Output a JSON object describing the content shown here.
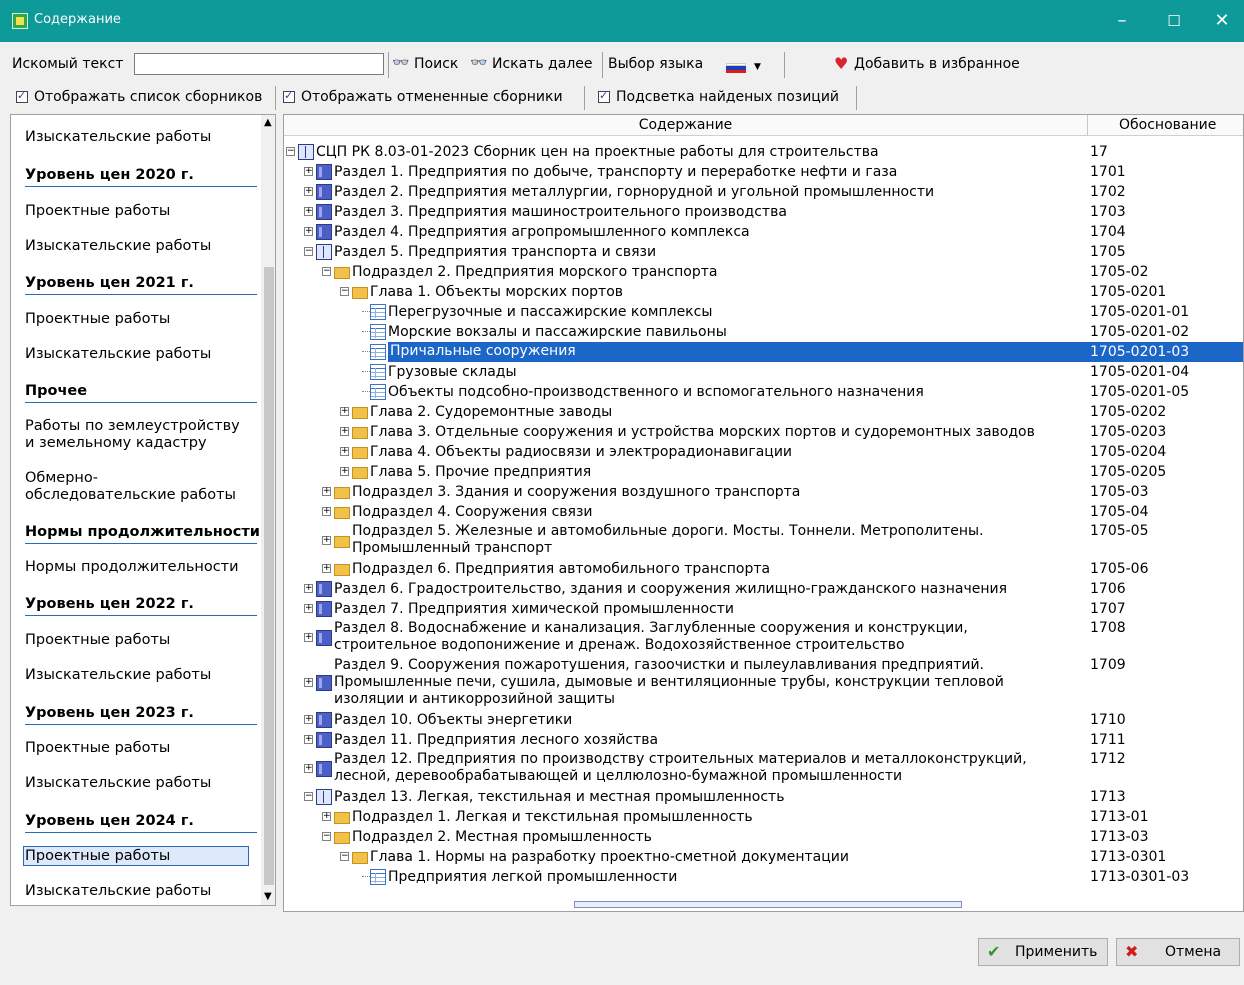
{
  "window": {
    "title": "Содержание",
    "minimize": "–",
    "maximize": "☐",
    "close": "✕"
  },
  "toolbar": {
    "search_label": "Искомый текст",
    "search_value": "",
    "find_btn": "Поиск",
    "find_next_btn": "Искать далее",
    "language_label": "Выбор языка",
    "favorite_btn": "Добавить в избранное",
    "show_collections": "Отображать список сборников",
    "show_cancelled": "Отображать отмененные сборники",
    "highlight_found": "Подсветка найденых позиций"
  },
  "left_panel": [
    {
      "type": "item",
      "label": "Изыскательские работы"
    },
    {
      "type": "head",
      "label": "Уровень цен 2020 г."
    },
    {
      "type": "item",
      "label": "Проектные работы"
    },
    {
      "type": "item",
      "label": "Изыскательские работы"
    },
    {
      "type": "head",
      "label": "Уровень цен 2021 г."
    },
    {
      "type": "item",
      "label": "Проектные работы"
    },
    {
      "type": "item",
      "label": "Изыскательские работы"
    },
    {
      "type": "head",
      "label": "Прочее"
    },
    {
      "type": "item",
      "label": "Работы по землеустройству и земельному кадастру"
    },
    {
      "type": "item",
      "label": "Обмерно-обследовательские работы"
    },
    {
      "type": "head",
      "label": "Нормы продолжительности"
    },
    {
      "type": "item",
      "label": "Нормы продолжительности"
    },
    {
      "type": "head",
      "label": "Уровень цен 2022 г."
    },
    {
      "type": "item",
      "label": "Проектные работы"
    },
    {
      "type": "item",
      "label": "Изыскательские работы"
    },
    {
      "type": "head",
      "label": "Уровень цен 2023 г."
    },
    {
      "type": "item",
      "label": "Проектные работы"
    },
    {
      "type": "item",
      "label": "Изыскательские работы"
    },
    {
      "type": "head",
      "label": "Уровень цен 2024 г."
    },
    {
      "type": "item",
      "label": "Проектные работы",
      "selected": true
    },
    {
      "type": "item",
      "label": "Изыскательские работы"
    }
  ],
  "tree": {
    "col_content": "Содержание",
    "col_basis": "Обоснование",
    "rows": [
      {
        "level": 0,
        "exp": "−",
        "icon": "open",
        "text": "СЦП РК 8.03-01-2023 Сборник цен на проектные работы для строительства",
        "code": "17"
      },
      {
        "level": 1,
        "exp": "+",
        "icon": "book",
        "text": "Раздел 1. Предприятия по добыче, транспорту и переработке нефти и газа",
        "code": "1701"
      },
      {
        "level": 1,
        "exp": "+",
        "icon": "book",
        "text": "Раздел 2. Предприятия металлургии, горнорудной и угольной промышленности",
        "code": "1702"
      },
      {
        "level": 1,
        "exp": "+",
        "icon": "book",
        "text": "Раздел 3. Предприятия машиностроительного производства",
        "code": "1703"
      },
      {
        "level": 1,
        "exp": "+",
        "icon": "book",
        "text": "Раздел 4. Предприятия агропромышленного комплекса",
        "code": "1704"
      },
      {
        "level": 1,
        "exp": "−",
        "icon": "open",
        "text": "Раздел 5. Предприятия транспорта и связи",
        "code": "1705"
      },
      {
        "level": 2,
        "exp": "−",
        "icon": "folder",
        "text": "Подраздел 2. Предприятия морского транспорта",
        "code": "1705-02"
      },
      {
        "level": 3,
        "exp": "−",
        "icon": "folder",
        "text": "Глава 1. Объекты морских портов",
        "code": "1705-0201"
      },
      {
        "level": 4,
        "exp": "",
        "icon": "table",
        "text": "Перегрузочные и пассажирские комплексы",
        "code": "1705-0201-01"
      },
      {
        "level": 4,
        "exp": "",
        "icon": "table",
        "text": "Морские вокзалы и пассажирские павильоны",
        "code": "1705-0201-02"
      },
      {
        "level": 4,
        "exp": "",
        "icon": "table",
        "text": "Причальные сооружения",
        "code": "1705-0201-03",
        "selected": true
      },
      {
        "level": 4,
        "exp": "",
        "icon": "table",
        "text": "Грузовые склады",
        "code": "1705-0201-04"
      },
      {
        "level": 4,
        "exp": "",
        "icon": "table",
        "text": "Объекты подсобно-производственного и вспомогательного назначения",
        "code": "1705-0201-05"
      },
      {
        "level": 3,
        "exp": "+",
        "icon": "folder",
        "text": "Глава 2. Судоремонтные заводы",
        "code": "1705-0202"
      },
      {
        "level": 3,
        "exp": "+",
        "icon": "folder",
        "text": "Глава 3. Отдельные сооружения и устройства морских портов и судоремонтных заводов",
        "code": "1705-0203"
      },
      {
        "level": 3,
        "exp": "+",
        "icon": "folder",
        "text": "Глава 4. Объекты радиосвязи и электрорадионавигации",
        "code": "1705-0204"
      },
      {
        "level": 3,
        "exp": "+",
        "icon": "folder",
        "text": "Глава 5. Прочие предприятия",
        "code": "1705-0205"
      },
      {
        "level": 2,
        "exp": "+",
        "icon": "folder",
        "text": "Подраздел 3. Здания и сооружения воздушного транспорта",
        "code": "1705-03"
      },
      {
        "level": 2,
        "exp": "+",
        "icon": "folder",
        "text": "Подраздел 4. Сооружения связи",
        "code": "1705-04"
      },
      {
        "level": 2,
        "exp": "+",
        "icon": "folder",
        "text": "Подраздел 5. Железные и автомобильные дороги. Мосты. Тоннели. Метрополитены.\nПромышленный транспорт",
        "code": "1705-05",
        "lines": 2
      },
      {
        "level": 2,
        "exp": "+",
        "icon": "folder",
        "text": "Подраздел 6. Предприятия автомобильного транспорта",
        "code": "1705-06"
      },
      {
        "level": 1,
        "exp": "+",
        "icon": "book",
        "text": "Раздел 6. Градостроительство, здания и сооружения жилищно-гражданского назначения",
        "code": "1706"
      },
      {
        "level": 1,
        "exp": "+",
        "icon": "book",
        "text": "Раздел 7. Предприятия химической промышленности",
        "code": "1707"
      },
      {
        "level": 1,
        "exp": "+",
        "icon": "book",
        "text": "Раздел 8. Водоснабжение и канализация. Заглубленные сооружения и конструкции,\nстроительное водопонижение и дренаж. Водохозяйственное строительство",
        "code": "1708",
        "lines": 2
      },
      {
        "level": 1,
        "exp": "+",
        "icon": "book",
        "text": "Раздел 9. Сооружения пожаротушения, газоочистки и пылеулавливания предприятий.\nПромышленные печи, сушила, дымовые и вентиляционные трубы, конструкции тепловой\nизоляции и антикоррозийной защиты",
        "code": "1709",
        "lines": 3
      },
      {
        "level": 1,
        "exp": "+",
        "icon": "book",
        "text": "Раздел 10. Объекты энергетики",
        "code": "1710"
      },
      {
        "level": 1,
        "exp": "+",
        "icon": "book",
        "text": "Раздел 11. Предприятия лесного хозяйства",
        "code": "1711"
      },
      {
        "level": 1,
        "exp": "+",
        "icon": "book",
        "text": "Раздел 12. Предприятия по производству строительных материалов и металлоконструкций,\nлесной, деревообрабатывающей и целлюлозно-бумажной промышленности",
        "code": "1712",
        "lines": 2
      },
      {
        "level": 1,
        "exp": "−",
        "icon": "open",
        "text": "Раздел 13. Легкая, текстильная и местная промышленность",
        "code": "1713"
      },
      {
        "level": 2,
        "exp": "+",
        "icon": "folder",
        "text": "Подраздел 1. Легкая и текстильная промышленность",
        "code": "1713-01"
      },
      {
        "level": 2,
        "exp": "−",
        "icon": "folder",
        "text": "Подраздел 2. Местная промышленность",
        "code": "1713-03"
      },
      {
        "level": 3,
        "exp": "−",
        "icon": "folder",
        "text": "Глава 1. Нормы на разработку проектно-сметной документации",
        "code": "1713-0301"
      },
      {
        "level": 4,
        "exp": "",
        "icon": "table",
        "text": "Предприятия легкой промышленности",
        "code": "1713-0301-03"
      }
    ]
  },
  "buttons": {
    "apply": "Применить",
    "cancel": "Отмена"
  }
}
